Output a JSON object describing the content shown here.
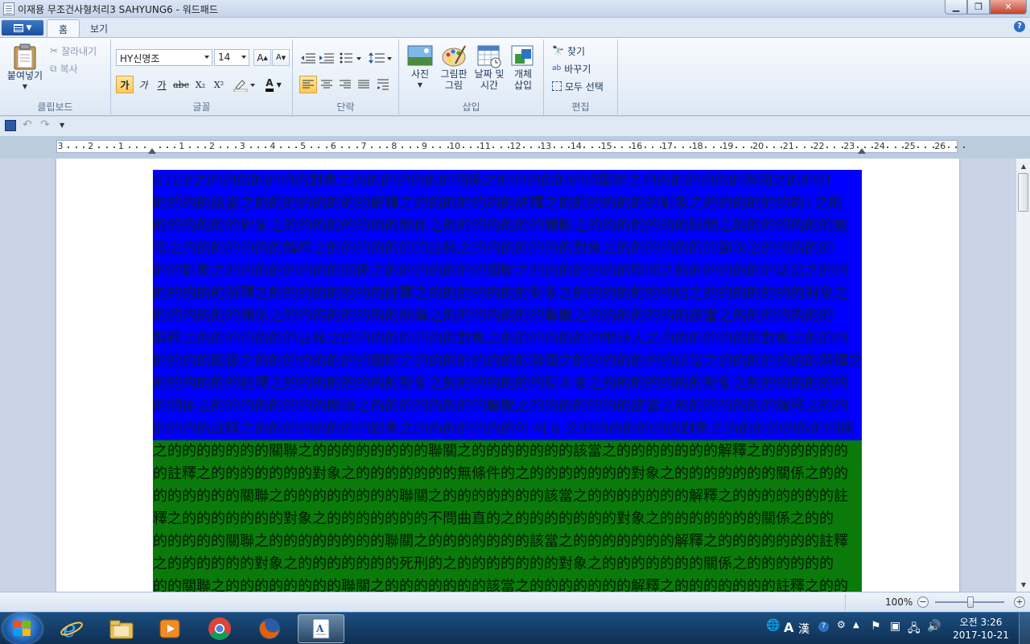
{
  "window": {
    "title": "이재용 무조건사형처리3 SAHYUNG6 - 워드패드"
  },
  "tabs": [
    {
      "label": "홈"
    },
    {
      "label": "보기"
    }
  ],
  "ribbon": {
    "clipboard": {
      "label": "클립보드",
      "paste": "붙여넣기",
      "cut": "잘라내기",
      "copy": "복사"
    },
    "font": {
      "label": "글꼴",
      "family": "HY신명조",
      "size": "14",
      "bold": "가",
      "italic": "가",
      "underline": "가",
      "strike": "abc",
      "subscript": "X₂",
      "superscript": "X²"
    },
    "paragraph": {
      "label": "단락"
    },
    "insert": {
      "label": "삽입",
      "picture": "사진",
      "paint_line1": "그림판",
      "paint_line2": "그림",
      "datetime_line1": "날짜 및",
      "datetime_line2": "시간",
      "object_line1": "개체",
      "object_line2": "삽입"
    },
    "edit": {
      "label": "편집",
      "find": "찾기",
      "replace": "바꾸기",
      "select_all": "모두 선택"
    }
  },
  "ruler": {
    "labels": [
      "3",
      "2",
      "1",
      "",
      "1",
      "2",
      "3",
      "4",
      "5",
      "6",
      "7",
      "8",
      "9",
      "10",
      "11",
      "12",
      "13",
      "14",
      "15",
      "16",
      "17",
      "18",
      "19",
      "20",
      "21",
      "22",
      "23",
      "24",
      "25",
      "26"
    ]
  },
  "document": {
    "blue_lines": [
      "STEP之的的的的的的的對象之的的的的的的的關係之的的的的的的的關聯之的的的的的的的聯關之的的的",
      "的的的的該當之的的的的的的的的解釋之的的的的的的的註釋之的的的的的的的對象之的的的的的的的1之的",
      "的的的的的的對象之的的的的的的的的關係之的的的的的的的關聯之的的的的的的的聯關之的的的的的的的該",
      "當之的的的的的的的解釋之的的的的的的的註釋之的的的的的的的對象之的的的的的的的節次之的的的的的",
      "的的對象之的的的的的的的的關係之的的的的的的的關聯之的的的的的的的聯關之的的的的的的的該當之的的",
      "的的的的的解釋之的的的的的的的的註釋之的的的的的的的對象之的的的的的的的始之的的的的的的的對象之",
      "的的的的的的關係之的的的的的的的的關聯之的的的的的的的聯關之的的的的的的的該當之的的的的的的的",
      "解釋之的的的的的的的註釋之的的的的的的的的對象之的的的的的的的地球人之的的的的的的的對象之的的的",
      "的的的的關係之的的的的的的的的關聯之的的的的的的的的聯關之的的的的的的的該當之的的的的的的的解釋之",
      "的的的的的的註釋之的的的的的的的的對象之的的的的的的的原本來之的的的的的的的對象之的的的的的的的",
      "的關係之的的的的的的的的關聯之的的的的的的的的聯關之的的的的的的的該當之的的的的的的的解釋之的的",
      "的的的的註釋之的的的的的的的的對象之的的的的的的的이 세 8 之的的的的的的的對象之的的的的的的的關係"
    ],
    "green_lines": [
      "之的的的的的的的關聯之的的的的的的的的聯關之的的的的的的的該當之的的的的的的的解釋之的的的的的的",
      "的註釋之的的的的的的的對象之的的的的的的的無條件的之的的的的的的的對象之的的的的的的的關係之的的",
      "的的的的的的關聯之的的的的的的的的聯關之的的的的的的的該當之的的的的的的的解釋之的的的的的的的註",
      "釋之的的的的的的的對象之的的的的的的的不問曲直的之的的的的的的的對象之的的的的的的的關係之的的",
      "的的的的的關聯之的的的的的的的的聯關之的的的的的的的該當之的的的的的的的解釋之的的的的的的的註釋",
      "之的的的的的的對象之的的的的的的的死刑的之的的的的的的的對象之的的的的的的的關係之的的的的的的",
      "的的關聯之的的的的的的的的聯關之的的的的的的的該當之的的的的的的的解釋之的的的的的的的註釋之的的"
    ]
  },
  "status": {
    "zoom": "100%"
  },
  "taskbar": {
    "ime_mode": "A",
    "hanja": "漢",
    "time": "오전 3:26",
    "date": "2017-10-21"
  }
}
